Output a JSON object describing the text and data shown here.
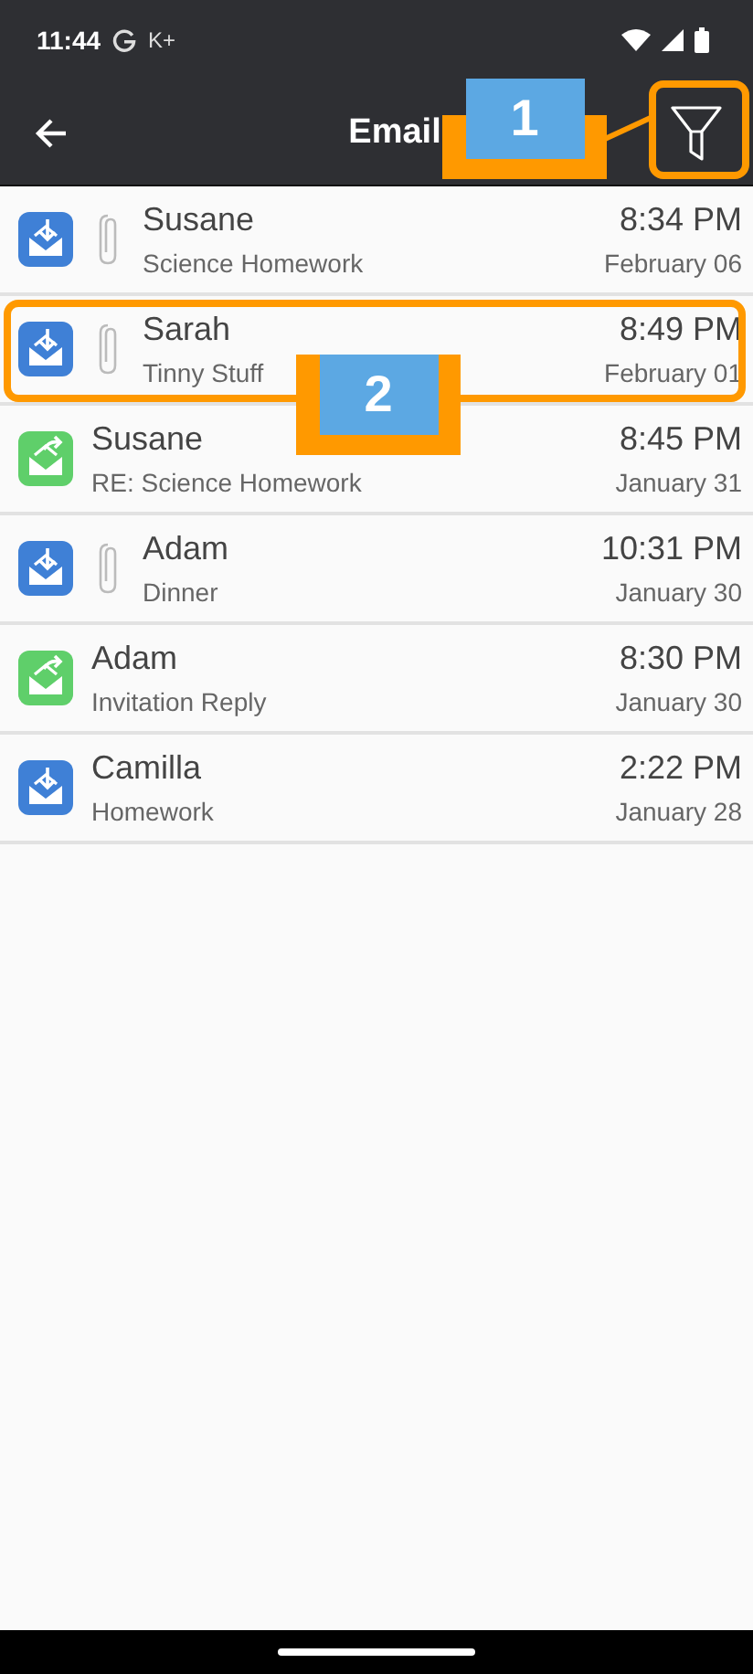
{
  "status_bar": {
    "time": "11:44",
    "carrier": "K+"
  },
  "app_bar": {
    "title": "Email"
  },
  "emails": [
    {
      "kind": "received",
      "sender": "Susane",
      "subject": "Science Homework",
      "time": "8:34 PM",
      "date": "February 06",
      "attachment": true,
      "highlighted": false
    },
    {
      "kind": "received",
      "sender": "Sarah",
      "subject": "Tinny Stuff",
      "time": "8:49 PM",
      "date": "February 01",
      "attachment": true,
      "highlighted": true
    },
    {
      "kind": "sent",
      "sender": "Susane",
      "subject": "RE: Science Homework",
      "time": "8:45 PM",
      "date": "January 31",
      "attachment": false,
      "highlighted": false
    },
    {
      "kind": "received",
      "sender": "Adam",
      "subject": "Dinner",
      "time": "10:31 PM",
      "date": "January 30",
      "attachment": true,
      "highlighted": false
    },
    {
      "kind": "sent",
      "sender": "Adam",
      "subject": "Invitation Reply",
      "time": "8:30 PM",
      "date": "January 30",
      "attachment": false,
      "highlighted": false
    },
    {
      "kind": "received",
      "sender": "Camilla",
      "subject": "Homework",
      "time": "2:22 PM",
      "date": "January 28",
      "attachment": false,
      "highlighted": false
    }
  ],
  "callouts": [
    {
      "label": "1"
    },
    {
      "label": "2"
    }
  ]
}
